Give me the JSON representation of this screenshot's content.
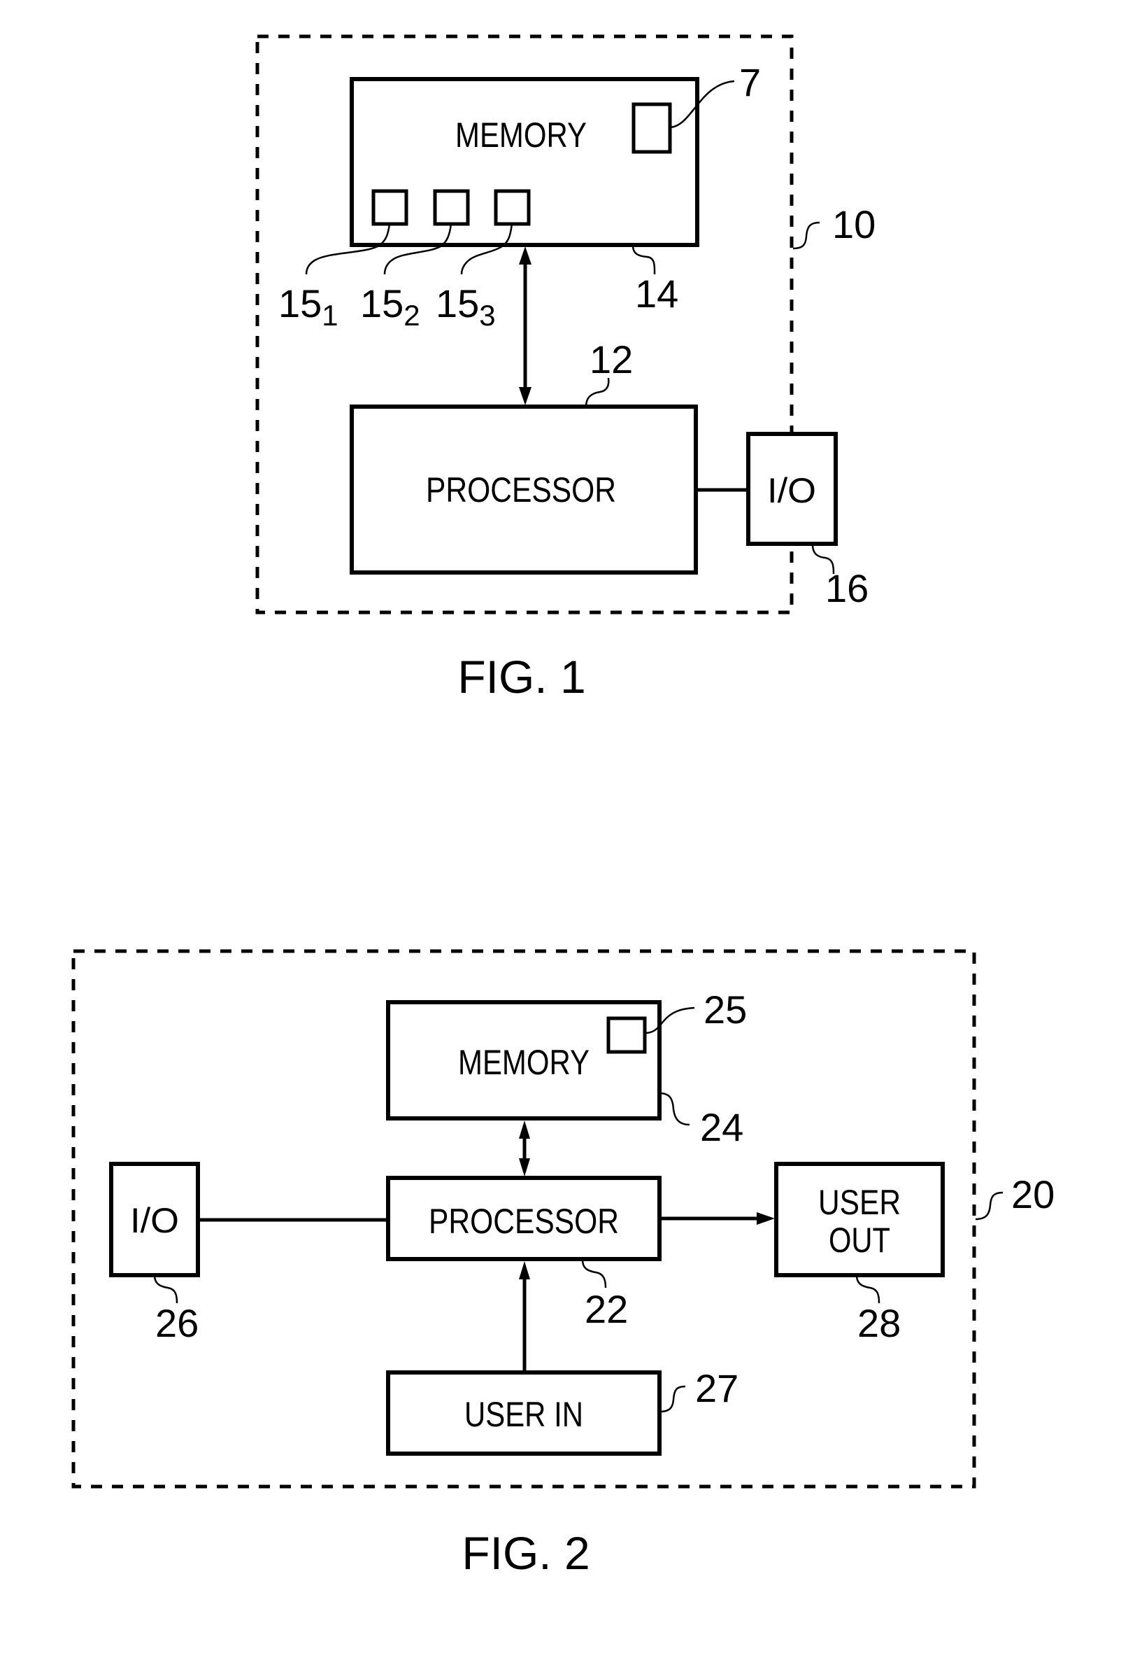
{
  "figure1": {
    "caption": "FIG. 1",
    "system_ref": "10",
    "memory": {
      "label": "MEMORY",
      "ref": "14",
      "item_ref": "7"
    },
    "sub_items": [
      {
        "base": "15",
        "sub": "1"
      },
      {
        "base": "15",
        "sub": "2"
      },
      {
        "base": "15",
        "sub": "3"
      }
    ],
    "processor": {
      "label": "PROCESSOR",
      "ref": "12"
    },
    "io": {
      "label": "I/O",
      "ref": "16"
    }
  },
  "figure2": {
    "caption": "FIG. 2",
    "system_ref": "20",
    "memory": {
      "label": "MEMORY",
      "ref": "24",
      "item_ref": "25"
    },
    "processor": {
      "label": "PROCESSOR",
      "ref": "22"
    },
    "io": {
      "label": "I/O",
      "ref": "26"
    },
    "user_out": {
      "label_line1": "USER",
      "label_line2": "OUT",
      "ref": "28"
    },
    "user_in": {
      "label": "USER IN",
      "ref": "27"
    }
  }
}
